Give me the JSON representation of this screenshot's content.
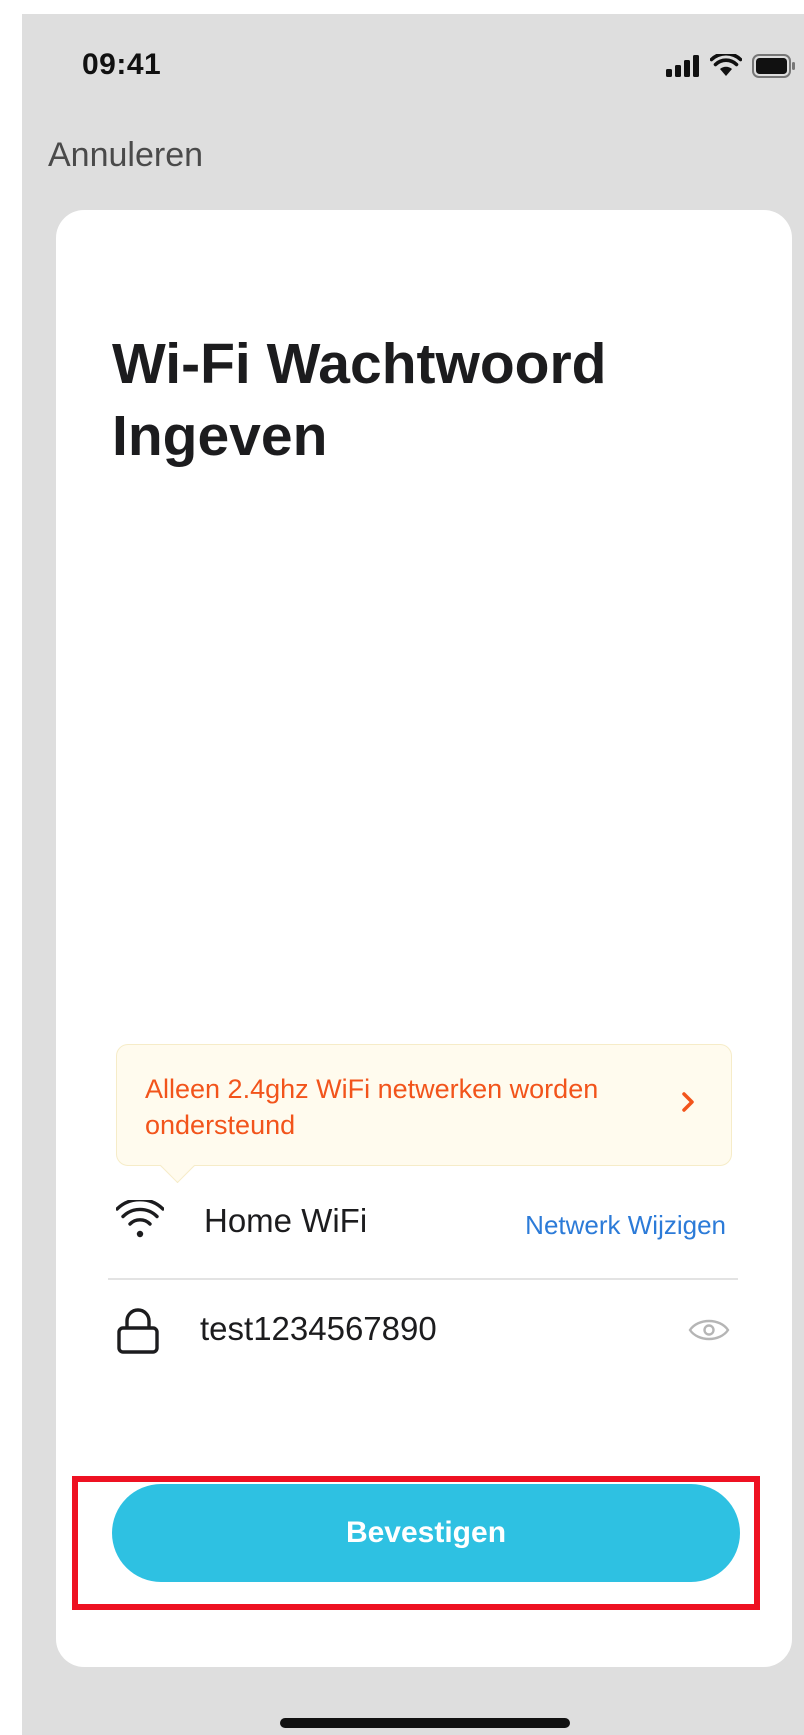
{
  "status_bar": {
    "time": "09:41",
    "icons": [
      "cellular-signal-icon",
      "wifi-icon",
      "battery-icon"
    ]
  },
  "nav": {
    "cancel_label": "Annuleren"
  },
  "card": {
    "title": "Wi-Fi Wachtwoord Ingeven",
    "notice": {
      "text": "Alleen 2.4ghz WiFi netwerken worden ondersteund",
      "color": "#f2541b",
      "icon": "chevron-right-icon"
    },
    "wifi_row": {
      "icon": "wifi-icon",
      "network_name": "Home WiFi",
      "change_label": "Netwerk Wijzigen"
    },
    "password_row": {
      "icon": "lock-icon",
      "value": "test1234567890",
      "toggle_icon": "eye-icon"
    },
    "confirm_label": "Bevestigen"
  },
  "colors": {
    "background": "#dedede",
    "card": "#ffffff",
    "accent": "#2ec1e2",
    "link": "#2c7bd8",
    "highlight_frame": "#ee1122"
  }
}
